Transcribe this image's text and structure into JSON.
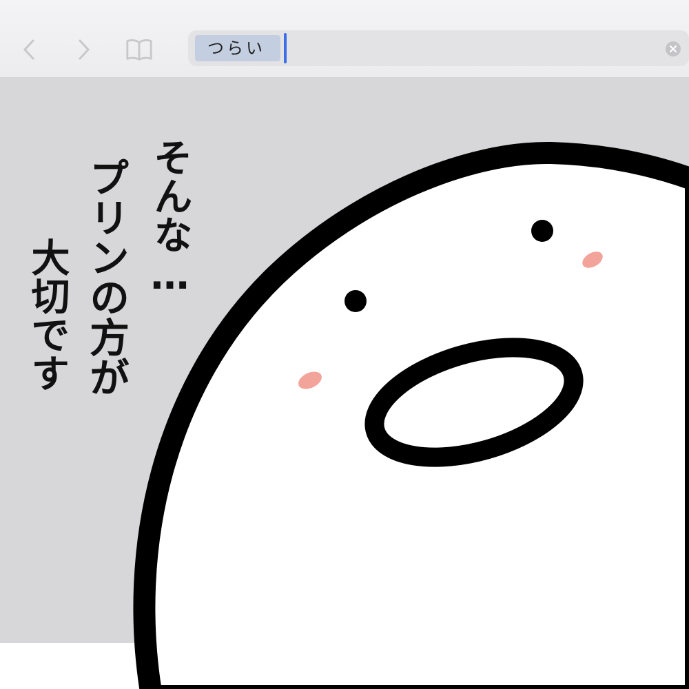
{
  "browser": {
    "address_text": "つらい",
    "icons": {
      "back": "chevron-left-icon",
      "forward": "chevron-right-icon",
      "bookmarks": "book-icon",
      "clear": "clear-circle-icon"
    }
  },
  "caption": {
    "line1": "そんな…",
    "line2": "プリンの方が",
    "line3": "大切です"
  },
  "colors": {
    "page_bg": "#d7d7da",
    "caret": "#3b6ee8",
    "selection": "#c3cfe0",
    "blush": "#f3a49a"
  }
}
